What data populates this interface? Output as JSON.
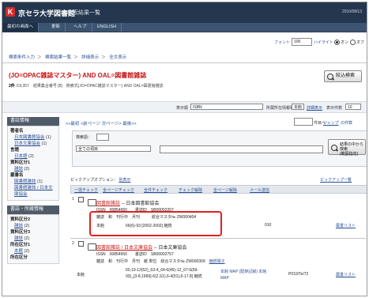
{
  "header": {
    "logo_char": "K",
    "library_name": "京セラ大学図書館",
    "page_name": "検索結果一覧",
    "date": "2010/08/13"
  },
  "nav": {
    "items": [
      "最初の画面へ",
      "更新",
      "ヘルプ",
      "ENGLISH"
    ]
  },
  "display": {
    "font_label": "フォント",
    "font_value": "100",
    "highlight_label": "ハイライト",
    "on_label": "オン",
    "off_label": "オフ"
  },
  "breadcrumb": [
    "検索条件入力",
    "検索結果一覧",
    "詳細表示",
    "全文表示"
  ],
  "query": {
    "text": "(JO=OPAC雑誌マスター) AND OAL=図書館雑誌",
    "hits_count": "2件",
    "hits_detail": "/19,357　結果集合番号 [8]　検索式(JO=OPAC雑誌マスター) AND OAL=図書館雑誌"
  },
  "refine_button": "絞込検索",
  "sortbar": {
    "display_label": "表示順",
    "display_value": "ISBN",
    "holdings_label": "所蔵所在情報等",
    "holdings_value": "本館",
    "holdings_link": "詳細表示",
    "per_page_label": "表示件数",
    "per_page_value": "10"
  },
  "sidebar": {
    "header": "書誌情報",
    "sections": [
      {
        "title": "著者名",
        "items": [
          {
            "label": "日本図書館協会",
            "count": "(1)"
          },
          {
            "label": "日本文庫協会",
            "count": "(1)"
          }
        ]
      },
      {
        "title": "言語",
        "items": [
          {
            "label": "日本語",
            "count": "(2)"
          }
        ]
      },
      {
        "title": "資料区分1",
        "items": [
          {
            "label": "雑誌",
            "count": "(2)"
          }
        ]
      },
      {
        "title": "叢書名",
        "items": [
          {
            "label": "図書館雑誌",
            "count": "(1)"
          },
          {
            "label": "図書館雑誌 / 日本文庫協会",
            "count": ""
          }
        ]
      }
    ],
    "header2": "書誌・所蔵情報",
    "sections2": [
      {
        "title": "資料区分2",
        "items": [
          {
            "label": "雑誌",
            "count": "(2)"
          }
        ]
      },
      {
        "title": "資料区分3",
        "items": [
          {
            "label": "雑誌",
            "count": "(2)"
          }
        ]
      },
      {
        "title": "所在区分1",
        "items": [
          {
            "label": "本館",
            "count": "(2)"
          }
        ]
      },
      {
        "title": "所在区分",
        "items": []
      }
    ]
  },
  "pager": {
    "links": "<<最初 <前ページ 次ページ> 最後>>",
    "page_label": "件目へ",
    "jump": "ジャンプ",
    "rest": "の件数"
  },
  "search_within": {
    "label": "検索語：",
    "field_value": "全ての項目",
    "button": "結果の中から検索",
    "button_line2": "(範囲指定)"
  },
  "pickup": {
    "label": "ピックアップオプション：",
    "link": "別表示",
    "right_link": "ピックアップ一覧"
  },
  "ops": [
    "一括チェック",
    "全ページチェック",
    "全件チェック",
    "チェック解除",
    "全ページ解除",
    "メール送信"
  ],
  "records": [
    {
      "num": "1",
      "title_link": "図書館雑誌",
      "title_rest": "-- 日本図書館協会",
      "issn": "ISSN　00854650　　書誌ID　SB00002207",
      "line2": "雑誌　和　刊行中　月刊　　　総合マスタ№ ZW000404",
      "line3_label": "本館",
      "line3_vol": "66(6)-93 [2002-2002] 継続",
      "line3_mid": "010",
      "line3_link": "蔵書リスト"
    },
    {
      "num": "2",
      "title_link": "図書館雑誌 / 日本文庫協会",
      "title_rest": "-- 日本文庫協会",
      "issn": "ISSN　00854650　　書誌ID　SB00002757",
      "line2_pre": "雑誌　和　刊行中　月刊　紙 単位　総合マスタ№ ZW000309　",
      "line2_link": "継続電子",
      "line3_label": "本館",
      "line3_vol": "60,10-12(52)_63-4_64-6(45)-12_67-6(69-93)_[3-8,1966]-6(2,S1),6-4(51),6-17.8] 継続",
      "line3_mid": "本館 MAP (配架記録) 本館 MAP",
      "line3_right": "P010/To/72",
      "line3_link": "蔵書リスト"
    }
  ]
}
